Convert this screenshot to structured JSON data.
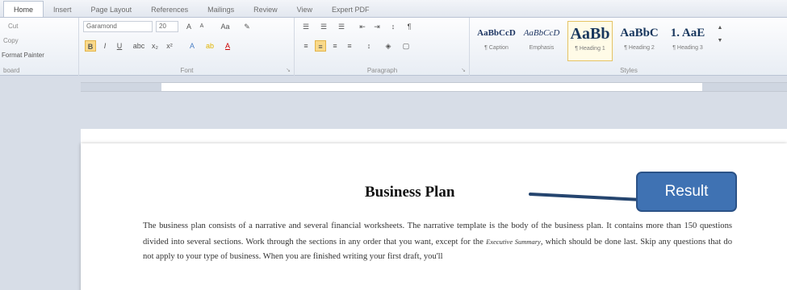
{
  "tabs": [
    "Home",
    "Insert",
    "Page Layout",
    "References",
    "Mailings",
    "Review",
    "View",
    "Expert PDF"
  ],
  "clipboard": {
    "cut": "Cut",
    "copy": "Copy",
    "format_painter": "Format Painter",
    "label": "board"
  },
  "font": {
    "name": "Garamond",
    "size": "20",
    "label": "Font"
  },
  "paragraph": {
    "label": "Paragraph"
  },
  "styles": {
    "label": "Styles",
    "items": [
      {
        "preview": "AaBbCcD",
        "name": "¶ Caption"
      },
      {
        "preview": "AaBbCcD",
        "name": "Emphasis"
      },
      {
        "preview": "AaBb",
        "name": "¶ Heading 1"
      },
      {
        "preview": "AaBbC",
        "name": "¶ Heading 2"
      },
      {
        "preview": "1. AaE",
        "name": "¶ Heading 3"
      }
    ]
  },
  "document": {
    "title": "Business Plan",
    "para_part1": "The business plan consists of a narrative and several financial worksheets. The narrative template is the body of the business plan. It contains more than 150 questions divided into several sections. Work through the sections in any order that you want, except for the ",
    "para_italic": "Executive Summary",
    "para_part2": ", which should be done last. Skip any questions that do not apply to your type of business. When you are finished writing your first draft, you'll"
  },
  "callout": {
    "label": "Result",
    "color": "#3f72b3"
  }
}
